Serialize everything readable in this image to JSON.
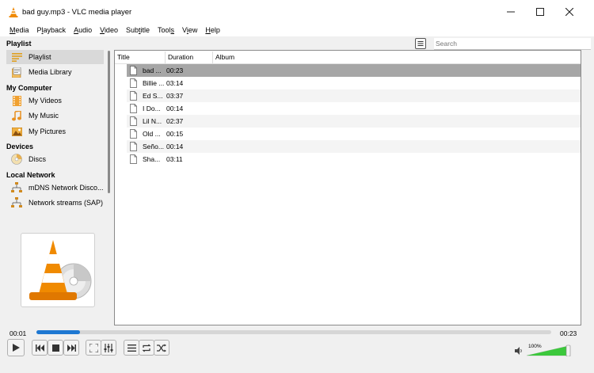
{
  "window": {
    "title": "bad guy.mp3 - VLC media player"
  },
  "menu": {
    "items": [
      "Media",
      "Playback",
      "Audio",
      "Video",
      "Subtitle",
      "Tools",
      "View",
      "Help"
    ],
    "accelerators": [
      "M",
      "l",
      "A",
      "V",
      "t",
      "s",
      "i",
      "H"
    ]
  },
  "sidebar": {
    "sections": {
      "playlist": "Playlist",
      "my_computer": "My Computer",
      "devices": "Devices",
      "local_network": "Local Network"
    },
    "items": [
      {
        "label": "Playlist",
        "icon": "playlist-icon"
      },
      {
        "label": "Media Library",
        "icon": "media-library-icon"
      },
      {
        "label": "My Videos",
        "icon": "film-icon"
      },
      {
        "label": "My Music",
        "icon": "music-note-icon"
      },
      {
        "label": "My Pictures",
        "icon": "picture-icon"
      },
      {
        "label": "Discs",
        "icon": "disc-icon"
      },
      {
        "label": "mDNS Network Disco...",
        "icon": "network-icon"
      },
      {
        "label": "Network streams (SAP)",
        "icon": "network-icon"
      }
    ]
  },
  "search": {
    "placeholder": "Search"
  },
  "playlist": {
    "columns": [
      "Title",
      "Duration",
      "Album"
    ],
    "rows": [
      {
        "title": "bad ...",
        "duration": "00:23"
      },
      {
        "title": "Billie ...",
        "duration": "03:14"
      },
      {
        "title": "Ed S...",
        "duration": "03:37"
      },
      {
        "title": "I Do...",
        "duration": "00:14"
      },
      {
        "title": "Lil N...",
        "duration": "02:37"
      },
      {
        "title": "Old ...",
        "duration": "00:15"
      },
      {
        "title": "Seño...",
        "duration": "00:14"
      },
      {
        "title": "Sha...",
        "duration": "03:11"
      }
    ],
    "current_index": 0
  },
  "player": {
    "elapsed": "00:01",
    "total": "00:23",
    "progress_fraction": 0.085,
    "volume_label": "100%",
    "volume_fraction": 1.0
  },
  "colors": {
    "accent": "#1e78d2",
    "selected_row": "#a6a6a6",
    "vlc_orange": "#f08a00",
    "volume_green": "#3cc83c"
  }
}
